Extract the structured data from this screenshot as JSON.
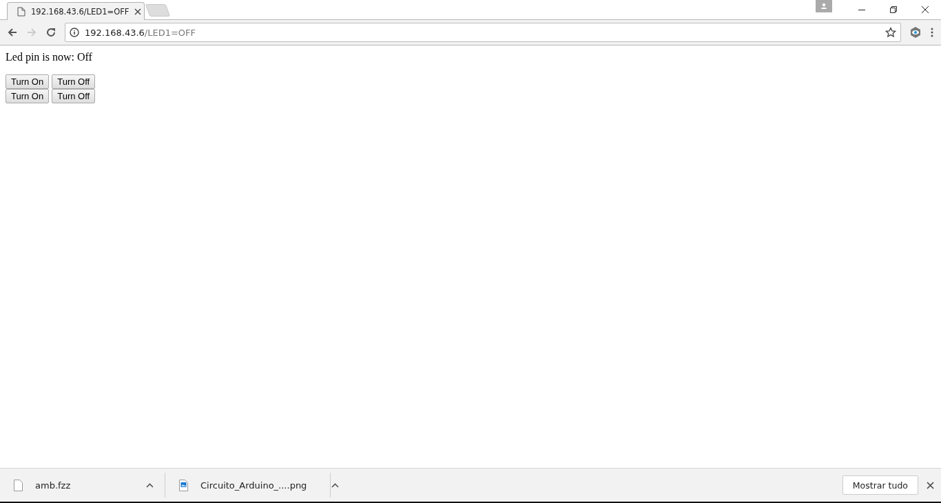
{
  "tab": {
    "title": "192.168.43.6/LED1=OFF",
    "selected": true
  },
  "address": {
    "host": "192.168.43.6",
    "path": "/LED1=OFF"
  },
  "page": {
    "status": "Led pin is now: Off",
    "button_rows": [
      [
        "Turn On",
        "Turn Off"
      ],
      [
        "Turn On",
        "Turn Off"
      ]
    ]
  },
  "downloads": {
    "items": [
      {
        "name": "amb.fzz",
        "kind": "file"
      },
      {
        "name": "Circuito_Arduino_....png",
        "kind": "image"
      }
    ],
    "show_all": "Mostrar tudo"
  }
}
